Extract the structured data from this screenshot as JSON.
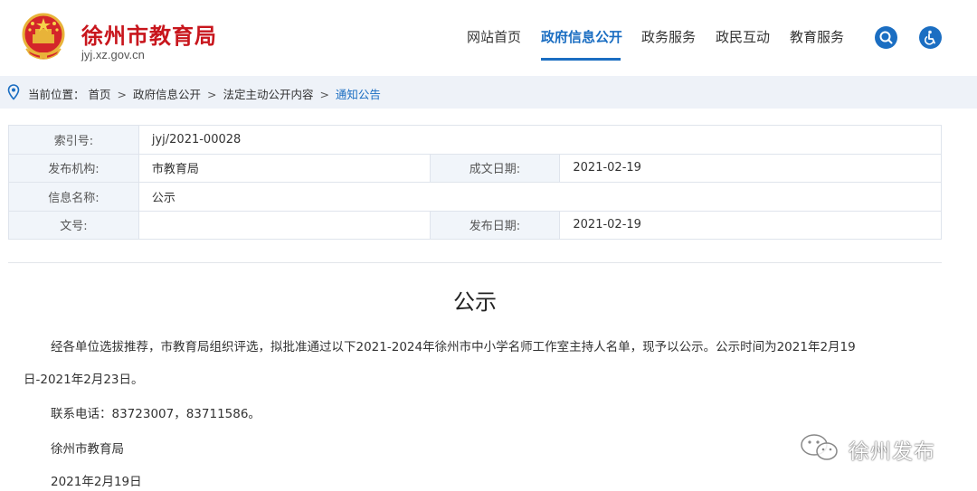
{
  "header": {
    "site_title": "徐州市教育局",
    "site_domain": "jyj.xz.gov.cn",
    "nav": [
      {
        "label": "网站首页",
        "active": false
      },
      {
        "label": "政府信息公开",
        "active": true
      },
      {
        "label": "政务服务",
        "active": false
      },
      {
        "label": "政民互动",
        "active": false
      },
      {
        "label": "教育服务",
        "active": false
      }
    ],
    "icons": [
      "search-icon",
      "accessibility-icon"
    ],
    "brand_color": "#c8161d",
    "accent_color": "#1b6ec2"
  },
  "breadcrumb": {
    "prefix": "当前位置：",
    "items": [
      "首页",
      "政府信息公开",
      "法定主动公开内容",
      "通知公告"
    ],
    "separator": ">"
  },
  "info_table": {
    "index_label": "索引号:",
    "index_value": "jyj/2021-00028",
    "publisher_label": "发布机构:",
    "publisher_value": "市教育局",
    "created_label": "成文日期:",
    "created_value": "2021-02-19",
    "name_label": "信息名称:",
    "name_value": "公示",
    "docno_label": "文号:",
    "docno_value": "",
    "published_label": "发布日期:",
    "published_value": "2021-02-19"
  },
  "article": {
    "title": "公示",
    "para1_line1": "经各单位选拔推荐，市教育局组织评选，拟批准通过以下2021-2024年徐州市中小学名师工作室主持人名单，现予以公示。公示时间为2021年2月19",
    "para1_line2": "日-2021年2月23日。",
    "contact": "联系电话：83723007，83711586。",
    "signature": "徐州市教育局",
    "date": "2021年2月19日"
  },
  "watermark": {
    "text": "徐州发布",
    "icon": "wechat-icon"
  }
}
